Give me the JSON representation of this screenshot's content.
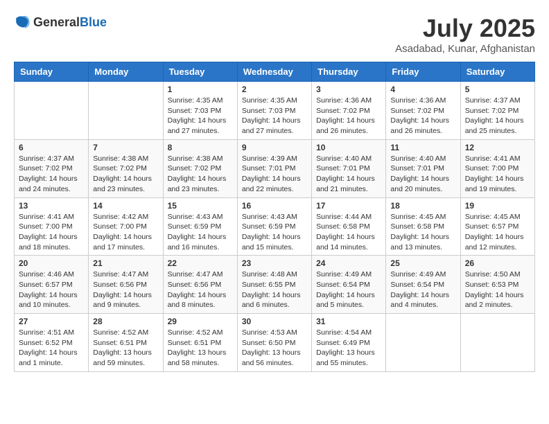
{
  "header": {
    "logo_general": "General",
    "logo_blue": "Blue",
    "month_title": "July 2025",
    "location": "Asadabad, Kunar, Afghanistan"
  },
  "weekdays": [
    "Sunday",
    "Monday",
    "Tuesday",
    "Wednesday",
    "Thursday",
    "Friday",
    "Saturday"
  ],
  "weeks": [
    [
      {
        "day": "",
        "sunrise": "",
        "sunset": "",
        "daylight": ""
      },
      {
        "day": "",
        "sunrise": "",
        "sunset": "",
        "daylight": ""
      },
      {
        "day": "1",
        "sunrise": "Sunrise: 4:35 AM",
        "sunset": "Sunset: 7:03 PM",
        "daylight": "Daylight: 14 hours and 27 minutes."
      },
      {
        "day": "2",
        "sunrise": "Sunrise: 4:35 AM",
        "sunset": "Sunset: 7:03 PM",
        "daylight": "Daylight: 14 hours and 27 minutes."
      },
      {
        "day": "3",
        "sunrise": "Sunrise: 4:36 AM",
        "sunset": "Sunset: 7:02 PM",
        "daylight": "Daylight: 14 hours and 26 minutes."
      },
      {
        "day": "4",
        "sunrise": "Sunrise: 4:36 AM",
        "sunset": "Sunset: 7:02 PM",
        "daylight": "Daylight: 14 hours and 26 minutes."
      },
      {
        "day": "5",
        "sunrise": "Sunrise: 4:37 AM",
        "sunset": "Sunset: 7:02 PM",
        "daylight": "Daylight: 14 hours and 25 minutes."
      }
    ],
    [
      {
        "day": "6",
        "sunrise": "Sunrise: 4:37 AM",
        "sunset": "Sunset: 7:02 PM",
        "daylight": "Daylight: 14 hours and 24 minutes."
      },
      {
        "day": "7",
        "sunrise": "Sunrise: 4:38 AM",
        "sunset": "Sunset: 7:02 PM",
        "daylight": "Daylight: 14 hours and 23 minutes."
      },
      {
        "day": "8",
        "sunrise": "Sunrise: 4:38 AM",
        "sunset": "Sunset: 7:02 PM",
        "daylight": "Daylight: 14 hours and 23 minutes."
      },
      {
        "day": "9",
        "sunrise": "Sunrise: 4:39 AM",
        "sunset": "Sunset: 7:01 PM",
        "daylight": "Daylight: 14 hours and 22 minutes."
      },
      {
        "day": "10",
        "sunrise": "Sunrise: 4:40 AM",
        "sunset": "Sunset: 7:01 PM",
        "daylight": "Daylight: 14 hours and 21 minutes."
      },
      {
        "day": "11",
        "sunrise": "Sunrise: 4:40 AM",
        "sunset": "Sunset: 7:01 PM",
        "daylight": "Daylight: 14 hours and 20 minutes."
      },
      {
        "day": "12",
        "sunrise": "Sunrise: 4:41 AM",
        "sunset": "Sunset: 7:00 PM",
        "daylight": "Daylight: 14 hours and 19 minutes."
      }
    ],
    [
      {
        "day": "13",
        "sunrise": "Sunrise: 4:41 AM",
        "sunset": "Sunset: 7:00 PM",
        "daylight": "Daylight: 14 hours and 18 minutes."
      },
      {
        "day": "14",
        "sunrise": "Sunrise: 4:42 AM",
        "sunset": "Sunset: 7:00 PM",
        "daylight": "Daylight: 14 hours and 17 minutes."
      },
      {
        "day": "15",
        "sunrise": "Sunrise: 4:43 AM",
        "sunset": "Sunset: 6:59 PM",
        "daylight": "Daylight: 14 hours and 16 minutes."
      },
      {
        "day": "16",
        "sunrise": "Sunrise: 4:43 AM",
        "sunset": "Sunset: 6:59 PM",
        "daylight": "Daylight: 14 hours and 15 minutes."
      },
      {
        "day": "17",
        "sunrise": "Sunrise: 4:44 AM",
        "sunset": "Sunset: 6:58 PM",
        "daylight": "Daylight: 14 hours and 14 minutes."
      },
      {
        "day": "18",
        "sunrise": "Sunrise: 4:45 AM",
        "sunset": "Sunset: 6:58 PM",
        "daylight": "Daylight: 14 hours and 13 minutes."
      },
      {
        "day": "19",
        "sunrise": "Sunrise: 4:45 AM",
        "sunset": "Sunset: 6:57 PM",
        "daylight": "Daylight: 14 hours and 12 minutes."
      }
    ],
    [
      {
        "day": "20",
        "sunrise": "Sunrise: 4:46 AM",
        "sunset": "Sunset: 6:57 PM",
        "daylight": "Daylight: 14 hours and 10 minutes."
      },
      {
        "day": "21",
        "sunrise": "Sunrise: 4:47 AM",
        "sunset": "Sunset: 6:56 PM",
        "daylight": "Daylight: 14 hours and 9 minutes."
      },
      {
        "day": "22",
        "sunrise": "Sunrise: 4:47 AM",
        "sunset": "Sunset: 6:56 PM",
        "daylight": "Daylight: 14 hours and 8 minutes."
      },
      {
        "day": "23",
        "sunrise": "Sunrise: 4:48 AM",
        "sunset": "Sunset: 6:55 PM",
        "daylight": "Daylight: 14 hours and 6 minutes."
      },
      {
        "day": "24",
        "sunrise": "Sunrise: 4:49 AM",
        "sunset": "Sunset: 6:54 PM",
        "daylight": "Daylight: 14 hours and 5 minutes."
      },
      {
        "day": "25",
        "sunrise": "Sunrise: 4:49 AM",
        "sunset": "Sunset: 6:54 PM",
        "daylight": "Daylight: 14 hours and 4 minutes."
      },
      {
        "day": "26",
        "sunrise": "Sunrise: 4:50 AM",
        "sunset": "Sunset: 6:53 PM",
        "daylight": "Daylight: 14 hours and 2 minutes."
      }
    ],
    [
      {
        "day": "27",
        "sunrise": "Sunrise: 4:51 AM",
        "sunset": "Sunset: 6:52 PM",
        "daylight": "Daylight: 14 hours and 1 minute."
      },
      {
        "day": "28",
        "sunrise": "Sunrise: 4:52 AM",
        "sunset": "Sunset: 6:51 PM",
        "daylight": "Daylight: 13 hours and 59 minutes."
      },
      {
        "day": "29",
        "sunrise": "Sunrise: 4:52 AM",
        "sunset": "Sunset: 6:51 PM",
        "daylight": "Daylight: 13 hours and 58 minutes."
      },
      {
        "day": "30",
        "sunrise": "Sunrise: 4:53 AM",
        "sunset": "Sunset: 6:50 PM",
        "daylight": "Daylight: 13 hours and 56 minutes."
      },
      {
        "day": "31",
        "sunrise": "Sunrise: 4:54 AM",
        "sunset": "Sunset: 6:49 PM",
        "daylight": "Daylight: 13 hours and 55 minutes."
      },
      {
        "day": "",
        "sunrise": "",
        "sunset": "",
        "daylight": ""
      },
      {
        "day": "",
        "sunrise": "",
        "sunset": "",
        "daylight": ""
      }
    ]
  ]
}
